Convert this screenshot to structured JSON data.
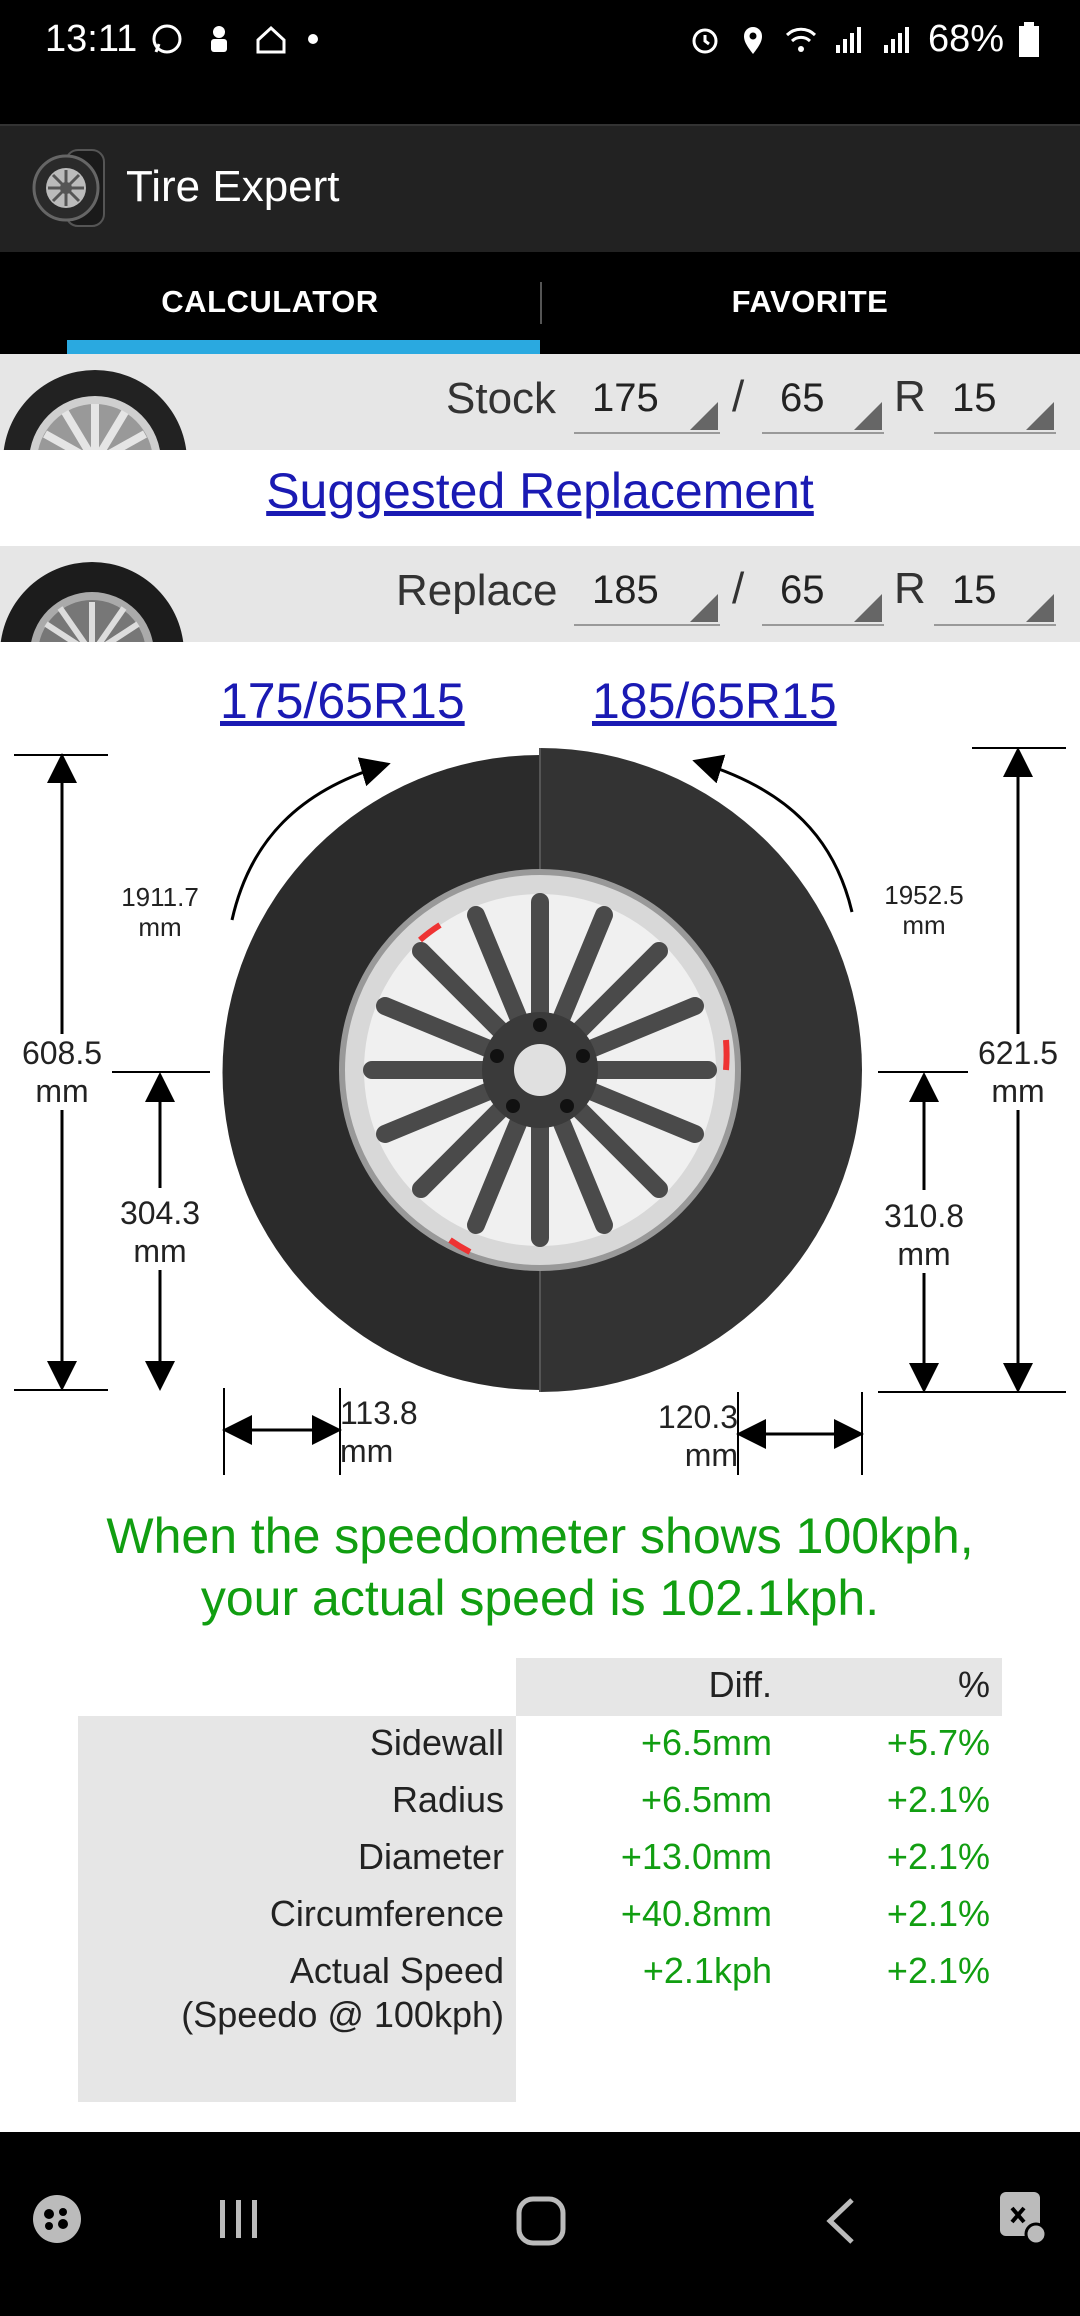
{
  "status_bar": {
    "time": "13:11",
    "battery": "68%"
  },
  "app": {
    "title": "Tire Expert"
  },
  "tabs": [
    {
      "label": "CALCULATOR",
      "selected": true
    },
    {
      "label": "FAVORITE",
      "selected": false
    }
  ],
  "stock": {
    "label": "Stock",
    "width": "175",
    "aspect": "65",
    "r_label": "R",
    "rim": "15",
    "separator": "/"
  },
  "suggested_link": "Suggested Replacement",
  "replace": {
    "label": "Replace",
    "width": "185",
    "aspect": "65",
    "r_label": "R",
    "rim": "15",
    "separator": "/"
  },
  "diagram": {
    "stock_size": "175/65R15",
    "replace_size": "185/65R15",
    "stock_circumference": "1911.7",
    "replace_circumference": "1952.5",
    "stock_diameter": "608.5",
    "replace_diameter": "621.5",
    "stock_radius": "304.3",
    "replace_radius": "310.8",
    "stock_sidewall": "113.8",
    "replace_sidewall": "120.3",
    "unit": "mm"
  },
  "speed_message": {
    "line1": "When the speedometer shows 100kph,",
    "line2": "your actual speed is 102.1kph."
  },
  "comparison": {
    "headers": {
      "diff": "Diff.",
      "pct": "%"
    },
    "rows": [
      {
        "label": "Sidewall",
        "diff": "+6.5mm",
        "pct": "+5.7%"
      },
      {
        "label": "Radius",
        "diff": "+6.5mm",
        "pct": "+2.1%"
      },
      {
        "label": "Diameter",
        "diff": "+13.0mm",
        "pct": "+2.1%"
      },
      {
        "label": "Circumference",
        "diff": "+40.8mm",
        "pct": "+2.1%"
      },
      {
        "label": "Actual Speed",
        "label2": "(Speedo @ 100kph)",
        "diff": "+2.1kph",
        "pct": "+2.1%"
      }
    ]
  },
  "colors": {
    "accent": "#2aa9e0",
    "link": "#1a1ab3",
    "positive": "#119e11"
  }
}
